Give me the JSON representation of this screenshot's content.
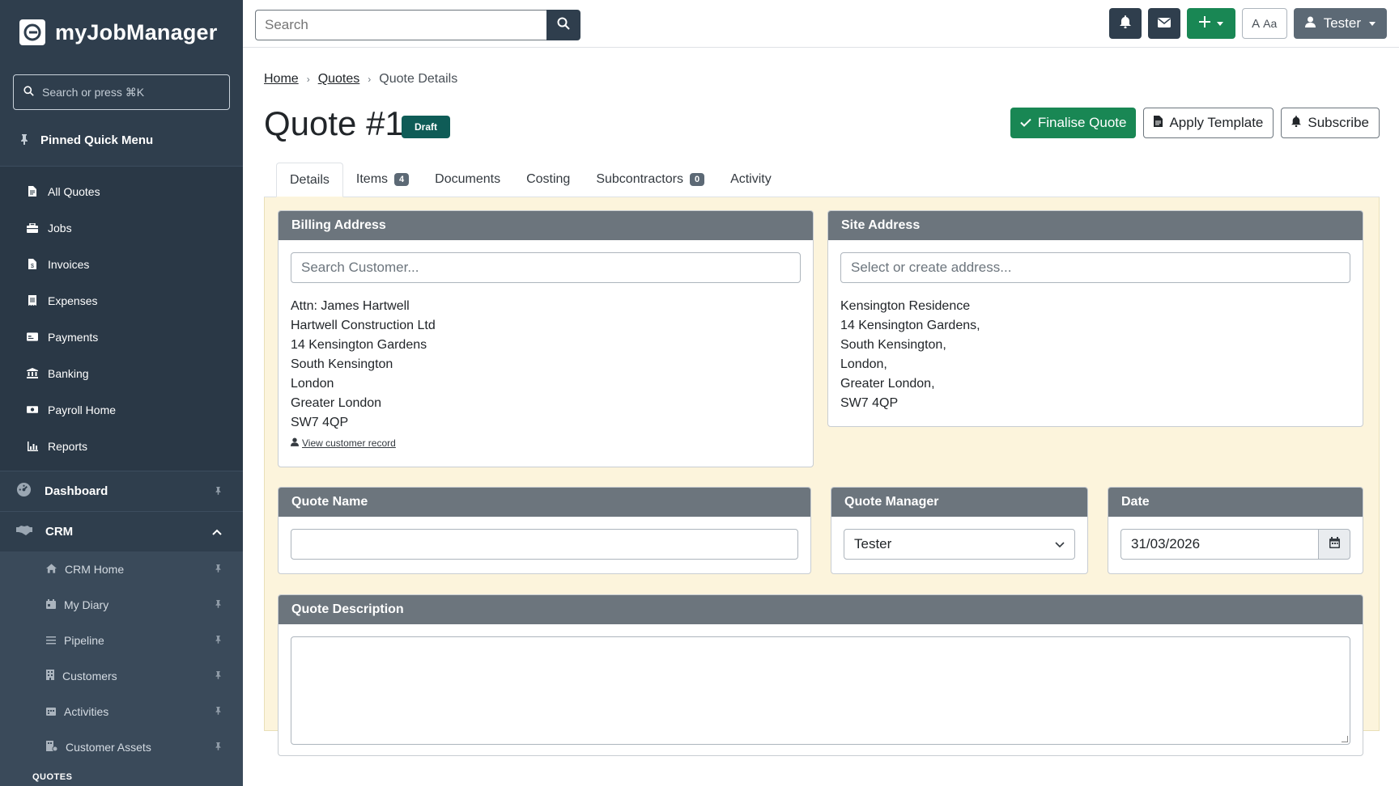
{
  "app": {
    "brand": "myJobManager"
  },
  "sidebar": {
    "search_placeholder": "Search or press ⌘K",
    "pinned_header": "Pinned Quick Menu",
    "pinned_items": [
      {
        "label": "All Quotes",
        "icon": "file-icon"
      },
      {
        "label": "Jobs",
        "icon": "toolbox-icon"
      },
      {
        "label": "Invoices",
        "icon": "invoice-icon"
      },
      {
        "label": "Expenses",
        "icon": "receipt-icon"
      },
      {
        "label": "Payments",
        "icon": "card-icon"
      },
      {
        "label": "Banking",
        "icon": "bank-icon"
      },
      {
        "label": "Payroll Home",
        "icon": "money-icon"
      },
      {
        "label": "Reports",
        "icon": "chart-icon"
      }
    ],
    "sections": {
      "dashboard": "Dashboard",
      "crm": "CRM"
    },
    "crm_items": [
      {
        "label": "CRM Home"
      },
      {
        "label": "My Diary"
      },
      {
        "label": "Pipeline"
      },
      {
        "label": "Customers"
      },
      {
        "label": "Activities"
      },
      {
        "label": "Customer Assets"
      }
    ],
    "next_section_label": "QUOTES"
  },
  "topbar": {
    "search_placeholder": "Search",
    "font_toggle": "Aa",
    "user_name": "Tester"
  },
  "breadcrumb": {
    "home": "Home",
    "quotes": "Quotes",
    "current": "Quote Details"
  },
  "page": {
    "title": "Quote #1",
    "status": "Draft",
    "actions": {
      "finalise": "Finalise Quote",
      "apply_template": "Apply Template",
      "subscribe": "Subscribe"
    }
  },
  "tabs": [
    {
      "label": "Details",
      "count": null,
      "active": true
    },
    {
      "label": "Items",
      "count": "4"
    },
    {
      "label": "Documents",
      "count": null
    },
    {
      "label": "Costing",
      "count": null
    },
    {
      "label": "Subcontractors",
      "count": "0"
    },
    {
      "label": "Activity",
      "count": null
    }
  ],
  "billing": {
    "title": "Billing Address",
    "placeholder": "Search Customer...",
    "lines": [
      "Attn: James Hartwell",
      "Hartwell Construction Ltd",
      "14 Kensington Gardens",
      "South Kensington",
      "London",
      "Greater London",
      "SW7 4QP"
    ],
    "view_link": "View customer record"
  },
  "site": {
    "title": "Site Address",
    "placeholder": "Select or create address...",
    "lines": [
      "Kensington Residence",
      "14 Kensington Gardens,",
      "South Kensington,",
      "London,",
      "Greater London,",
      "SW7 4QP"
    ]
  },
  "quote_name": {
    "title": "Quote Name",
    "value": ""
  },
  "quote_manager": {
    "title": "Quote Manager",
    "value": "Tester"
  },
  "date": {
    "title": "Date",
    "value": "31/03/2026"
  },
  "description": {
    "title": "Quote Description",
    "value": ""
  },
  "colors": {
    "sidebar": "#2f3e4d",
    "green": "#198754",
    "badge": "#0f5c57",
    "panel_bg": "#fcf4dc",
    "card_head": "#6c757d"
  }
}
